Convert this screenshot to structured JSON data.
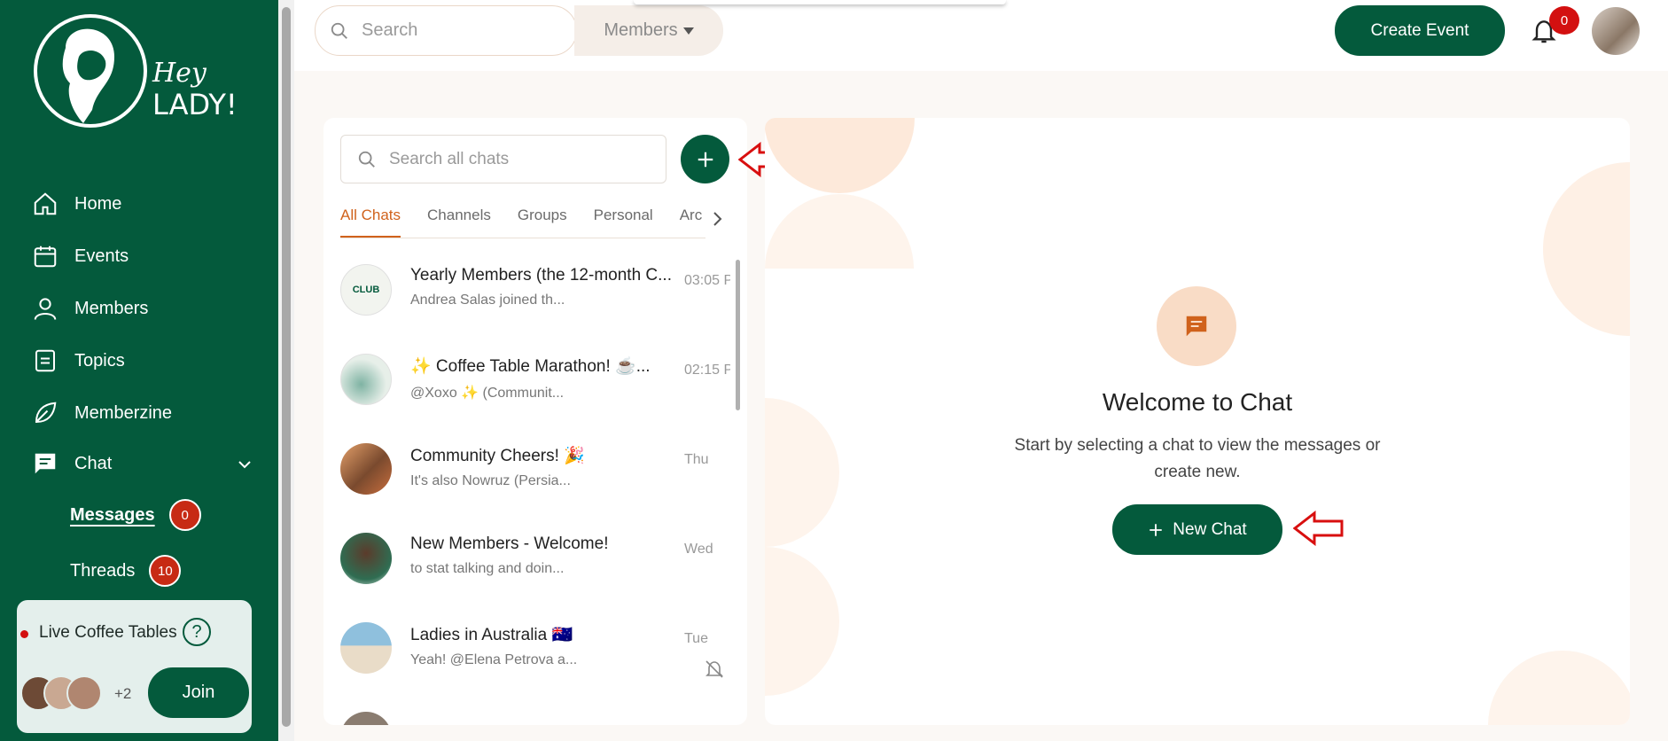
{
  "brand": {
    "logo_text_line1": "Hey",
    "logo_text_line2": "LADY!",
    "color": "#045a3c"
  },
  "sidebar": {
    "items": [
      {
        "label": "Home",
        "icon": "home-icon"
      },
      {
        "label": "Events",
        "icon": "calendar-icon"
      },
      {
        "label": "Members",
        "icon": "person-icon"
      },
      {
        "label": "Topics",
        "icon": "document-icon"
      },
      {
        "label": "Memberzine",
        "icon": "leaf-icon"
      },
      {
        "label": "Chat",
        "icon": "chat-icon",
        "expanded": true
      }
    ],
    "sub_items": [
      {
        "label": "Messages",
        "count": "0",
        "active": true
      },
      {
        "label": "Threads",
        "count": "10"
      }
    ],
    "coffee": {
      "title": "Live Coffee Tables",
      "help": "?",
      "extra": "+2",
      "join": "Join"
    }
  },
  "topbar": {
    "search_placeholder": "Search",
    "filter": "Members",
    "create_event": "Create Event",
    "notifications": "0"
  },
  "chatlist": {
    "search_placeholder": "Search all chats",
    "tabs": [
      "All Chats",
      "Channels",
      "Groups",
      "Personal",
      "Arc"
    ],
    "active_tab": "All Chats",
    "chats": [
      {
        "name": "Yearly Members (the 12-month C...",
        "last": "Andrea Salas joined th...",
        "time": "03:05 P"
      },
      {
        "name": "✨ Coffee Table Marathon! ☕...",
        "last": "@Xoxo ✨ (Communit...",
        "time": "02:15 P"
      },
      {
        "name": "Community Cheers! 🎉",
        "last": "It's also Nowruz (Persia...",
        "time": "Thu"
      },
      {
        "name": "New Members - Welcome!",
        "last": "to stat talking and doin...",
        "time": "Wed"
      },
      {
        "name": "Ladies in Australia 🇦🇺",
        "last": "Yeah! @Elena Petrova a...",
        "time": "Tue",
        "muted": true
      }
    ]
  },
  "welcome": {
    "title": "Welcome to Chat",
    "subtitle": "Start by selecting a chat to view the messages or create new.",
    "button": "New Chat"
  },
  "colors": {
    "accent": "#d0621c",
    "badge": "#c72a14",
    "peach": "#f9dcc6"
  }
}
